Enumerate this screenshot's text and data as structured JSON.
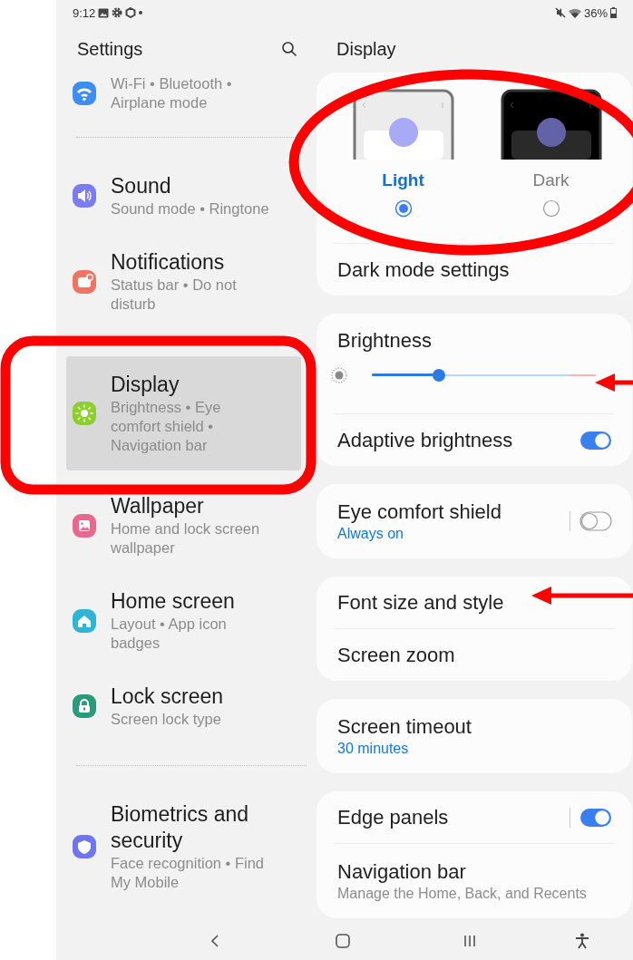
{
  "status_bar": {
    "time": "9:12",
    "battery": "36%"
  },
  "sidebar": {
    "title": "Settings",
    "items": [
      {
        "kind": "item",
        "color": "#3d8ef0",
        "subtitle": "Wi-Fi • Bluetooth • Airplane mode",
        "selected": false
      },
      {
        "kind": "divider"
      },
      {
        "kind": "item",
        "color": "#7b7cf0",
        "title": "Sound",
        "subtitle": "Sound mode • Ringtone",
        "selected": false
      },
      {
        "kind": "item",
        "color": "#ee7464",
        "title": "Notifications",
        "subtitle": "Status bar • Do not disturb",
        "selected": false
      },
      {
        "kind": "item",
        "color": "#8ccf2b",
        "title": "Display",
        "subtitle": "Brightness • Eye comfort shield • Navigation bar",
        "selected": true
      },
      {
        "kind": "item",
        "color": "#e56a8e",
        "title": "Wallpaper",
        "subtitle": "Home and lock screen wallpaper",
        "selected": false
      },
      {
        "kind": "item",
        "color": "#2fb4d8",
        "title": "Home screen",
        "subtitle": "Layout • App icon badges",
        "selected": false
      },
      {
        "kind": "item",
        "color": "#2a9a7c",
        "title": "Lock screen",
        "subtitle": "Screen lock type",
        "selected": false
      },
      {
        "kind": "divider"
      },
      {
        "kind": "item",
        "color": "#6f74ef",
        "title": "Biometrics and security",
        "subtitle": "Face recognition • Find My Mobile",
        "selected": false
      }
    ]
  },
  "display": {
    "title": "Display",
    "cards": [
      {
        "rows": [
          {
            "kind": "theme",
            "options": [
              {
                "kind": "light",
                "label": "Light",
                "selected": true
              },
              {
                "kind": "dark",
                "label": "Dark",
                "selected": false
              }
            ]
          },
          {
            "kind": "link",
            "title": "Dark mode settings"
          }
        ]
      },
      {
        "rows": [
          {
            "kind": "slider",
            "title": "Brightness",
            "level": 0.3
          },
          {
            "kind": "toggle",
            "title": "Adaptive brightness",
            "on": true,
            "separator": false
          }
        ]
      },
      {
        "rows": [
          {
            "kind": "toggle",
            "title": "Eye comfort shield",
            "subtitle": "Always on",
            "on": false,
            "separator": true
          }
        ]
      },
      {
        "rows": [
          {
            "kind": "link",
            "title": "Font size and style"
          },
          {
            "kind": "link",
            "title": "Screen zoom"
          }
        ]
      },
      {
        "rows": [
          {
            "kind": "link",
            "title": "Screen timeout",
            "subtitle": "30 minutes"
          }
        ]
      },
      {
        "rows": [
          {
            "kind": "toggle",
            "title": "Edge panels",
            "on": true,
            "separator": true
          },
          {
            "kind": "link",
            "title": "Navigation bar",
            "subtitle": "Manage the Home, Back, and Recents"
          }
        ]
      }
    ]
  },
  "annotations": [
    {
      "kind": "ellipse"
    },
    {
      "kind": "frame"
    },
    {
      "kind": "arrow"
    },
    {
      "kind": "arrow"
    }
  ]
}
